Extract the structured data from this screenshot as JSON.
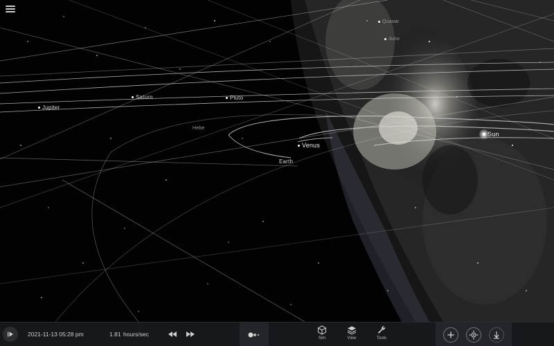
{
  "app": {
    "menu_icon": "hamburger-menu-icon"
  },
  "scene": {
    "labels": {
      "quaoar": "Quaoar",
      "juno": "Juno",
      "saturn": "Saturn",
      "pluto": "Pluto",
      "jupiter": "Jupiter",
      "hebe": "Hebe",
      "sun": "Sun",
      "venus": "Venus",
      "earth": "Earth"
    }
  },
  "toolbar": {
    "play_icon": "play-pause-icon",
    "datetime": "2021-11-13 05:28 pm",
    "rate_value": "1.81",
    "rate_unit": "hours/sec",
    "rewind_icon": "rewind-icon",
    "fast_forward_icon": "fast-forward-icon",
    "center_icon": "planet-system-icon",
    "tools": {
      "sim_label": "Sim",
      "view_label": "View",
      "tools_label": "Tools"
    },
    "right_icons": [
      "zoom-in-icon",
      "recenter-icon",
      "gravity-icon"
    ]
  }
}
